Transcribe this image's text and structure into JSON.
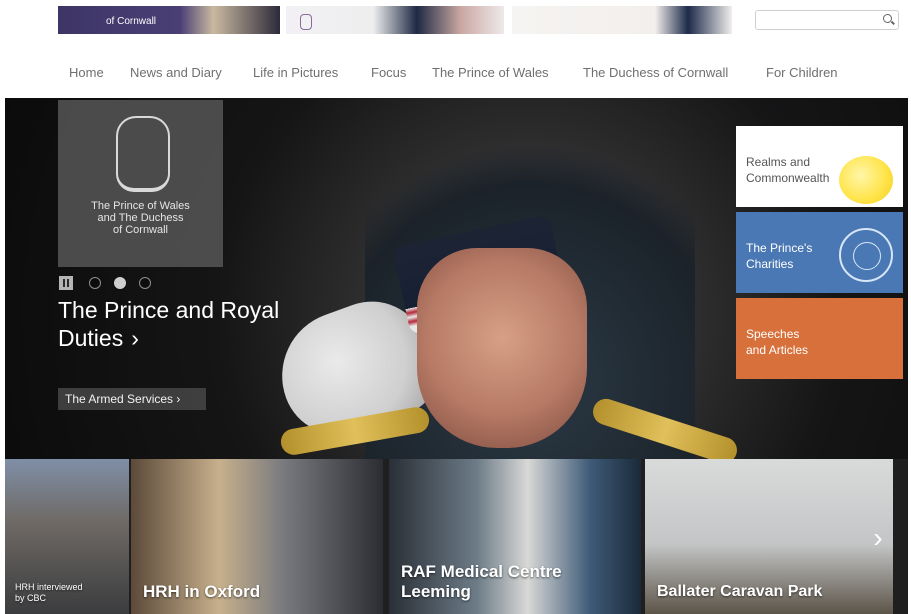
{
  "top_strip": {
    "thumb1_label": "of Cornwall",
    "search": {
      "placeholder": ""
    }
  },
  "nav": {
    "items": [
      {
        "label": "Home"
      },
      {
        "label": "News and Diary"
      },
      {
        "label": "Life in Pictures"
      },
      {
        "label": "Focus"
      },
      {
        "label": "The Prince of Wales"
      },
      {
        "label": "The Duchess of Cornwall"
      },
      {
        "label": "For Children"
      }
    ]
  },
  "hero": {
    "emblem_text": "The Prince of Wales\nand The Duchess\nof Cornwall",
    "title_line1": "The Prince and Royal",
    "title_line2": "Duties",
    "title_chevron": "›",
    "button_label": "The Armed Services ›",
    "carousel": {
      "total": 3,
      "active": 2
    }
  },
  "side_tiles": [
    {
      "label": "Realms and\nCommonwealth",
      "color": "#ffffff"
    },
    {
      "label": "The Prince's\nCharities",
      "color": "#4a78b4"
    },
    {
      "label": "Speeches\nand Articles",
      "color": "#d8703b"
    }
  ],
  "bottom_cards": [
    {
      "caption": "HRH interviewed\nby CBC"
    },
    {
      "caption": "HRH in Oxford"
    },
    {
      "caption": "RAF Medical Centre\nLeeming"
    },
    {
      "caption": "Ballater Caravan Park"
    }
  ],
  "next_arrow": "›"
}
